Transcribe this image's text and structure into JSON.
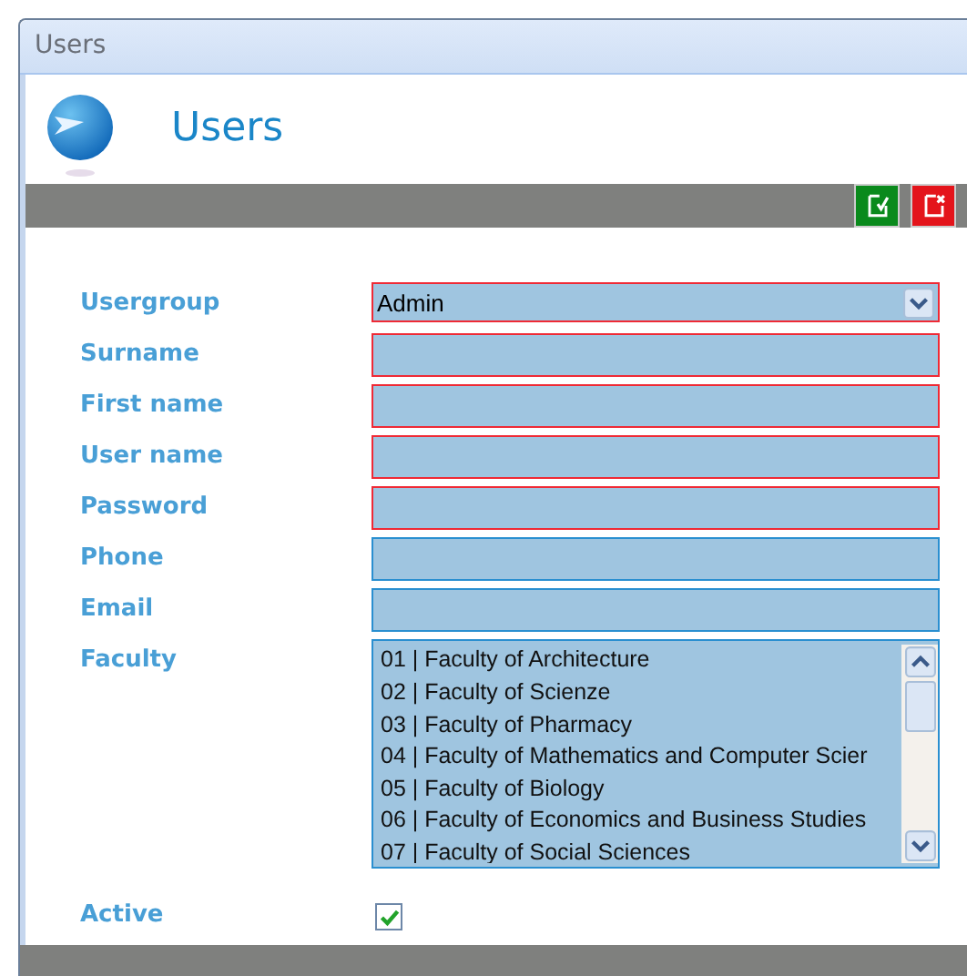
{
  "window": {
    "title": "Users"
  },
  "header": {
    "title": "Users"
  },
  "toolbar": {
    "buttons": [
      {
        "kind": "save"
      },
      {
        "kind": "cancel"
      }
    ]
  },
  "form": {
    "fields": [
      {
        "label": "Usergroup",
        "kind": "select",
        "value": "Admin",
        "required": true
      },
      {
        "label": "Surname",
        "kind": "text",
        "required": true
      },
      {
        "label": "First name",
        "kind": "text",
        "required": true
      },
      {
        "label": "User name",
        "kind": "text",
        "required": true
      },
      {
        "label": "Password",
        "kind": "text",
        "required": true
      },
      {
        "label": "Phone",
        "kind": "text",
        "required": false
      },
      {
        "label": "Email",
        "kind": "text",
        "required": false
      },
      {
        "label": "Faculty",
        "kind": "list",
        "required": false,
        "options": [
          "01 | Faculty of Architecture",
          "02 | Faculty of Scienze",
          "03 | Faculty of Pharmacy",
          "04 | Faculty of Mathematics and Computer Scier",
          "05 | Faculty of Biology",
          "06 | Faculty of Economics and Business Studies",
          "07 | Faculty of Social Sciences"
        ]
      },
      {
        "label": "Active",
        "kind": "checkbox",
        "checked": true
      }
    ]
  }
}
